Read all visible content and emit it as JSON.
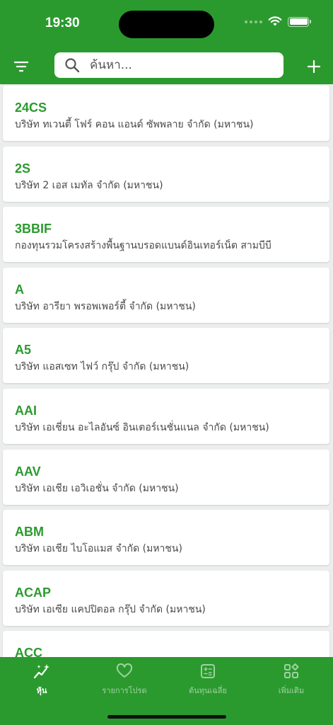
{
  "status_bar": {
    "time": "19:30"
  },
  "header": {
    "search_placeholder": "ค้นหา..."
  },
  "stocks": [
    {
      "symbol": "24CS",
      "name": "บริษัท ทเวนตี้ โฟร์ คอน แอนด์ ซัพพลาย จำกัด (มหาชน)"
    },
    {
      "symbol": "2S",
      "name": "บริษัท 2 เอส เมทัล จำกัด (มหาชน)"
    },
    {
      "symbol": "3BBIF",
      "name": "กองทุนรวมโครงสร้างพื้นฐานบรอดแบนด์อินเทอร์เน็ต สามบีบี"
    },
    {
      "symbol": "A",
      "name": "บริษัท อารียา พรอพเพอร์ตี้ จำกัด (มหาชน)"
    },
    {
      "symbol": "A5",
      "name": "บริษัท แอสเซท ไฟว์ กรุ๊ป จำกัด (มหาชน)"
    },
    {
      "symbol": "AAI",
      "name": "บริษัท เอเชี่ยน อะไลอันซ์ อินเตอร์เนชั่นแนล จำกัด (มหาชน)"
    },
    {
      "symbol": "AAV",
      "name": "บริษัท เอเชีย เอวิเอชั่น จำกัด (มหาชน)"
    },
    {
      "symbol": "ABM",
      "name": "บริษัท เอเชีย ไบโอแมส จำกัด (มหาชน)"
    },
    {
      "symbol": "ACAP",
      "name": "บริษัท เอเซีย แคปปิตอล กรุ๊ป จำกัด (มหาชน)"
    },
    {
      "symbol": "ACC",
      "name": ""
    }
  ],
  "tabs": [
    {
      "label": "หุ้น",
      "icon": "chart-sparkle-icon",
      "active": true
    },
    {
      "label": "รายการโปรด",
      "icon": "heart-icon",
      "active": false
    },
    {
      "label": "ต้นทุนเฉลี่ย",
      "icon": "calculator-icon",
      "active": false
    },
    {
      "label": "เพิ่มเติม",
      "icon": "grid-more-icon",
      "active": false
    }
  ],
  "colors": {
    "brand": "#2b9a2e",
    "background": "#eceded"
  }
}
